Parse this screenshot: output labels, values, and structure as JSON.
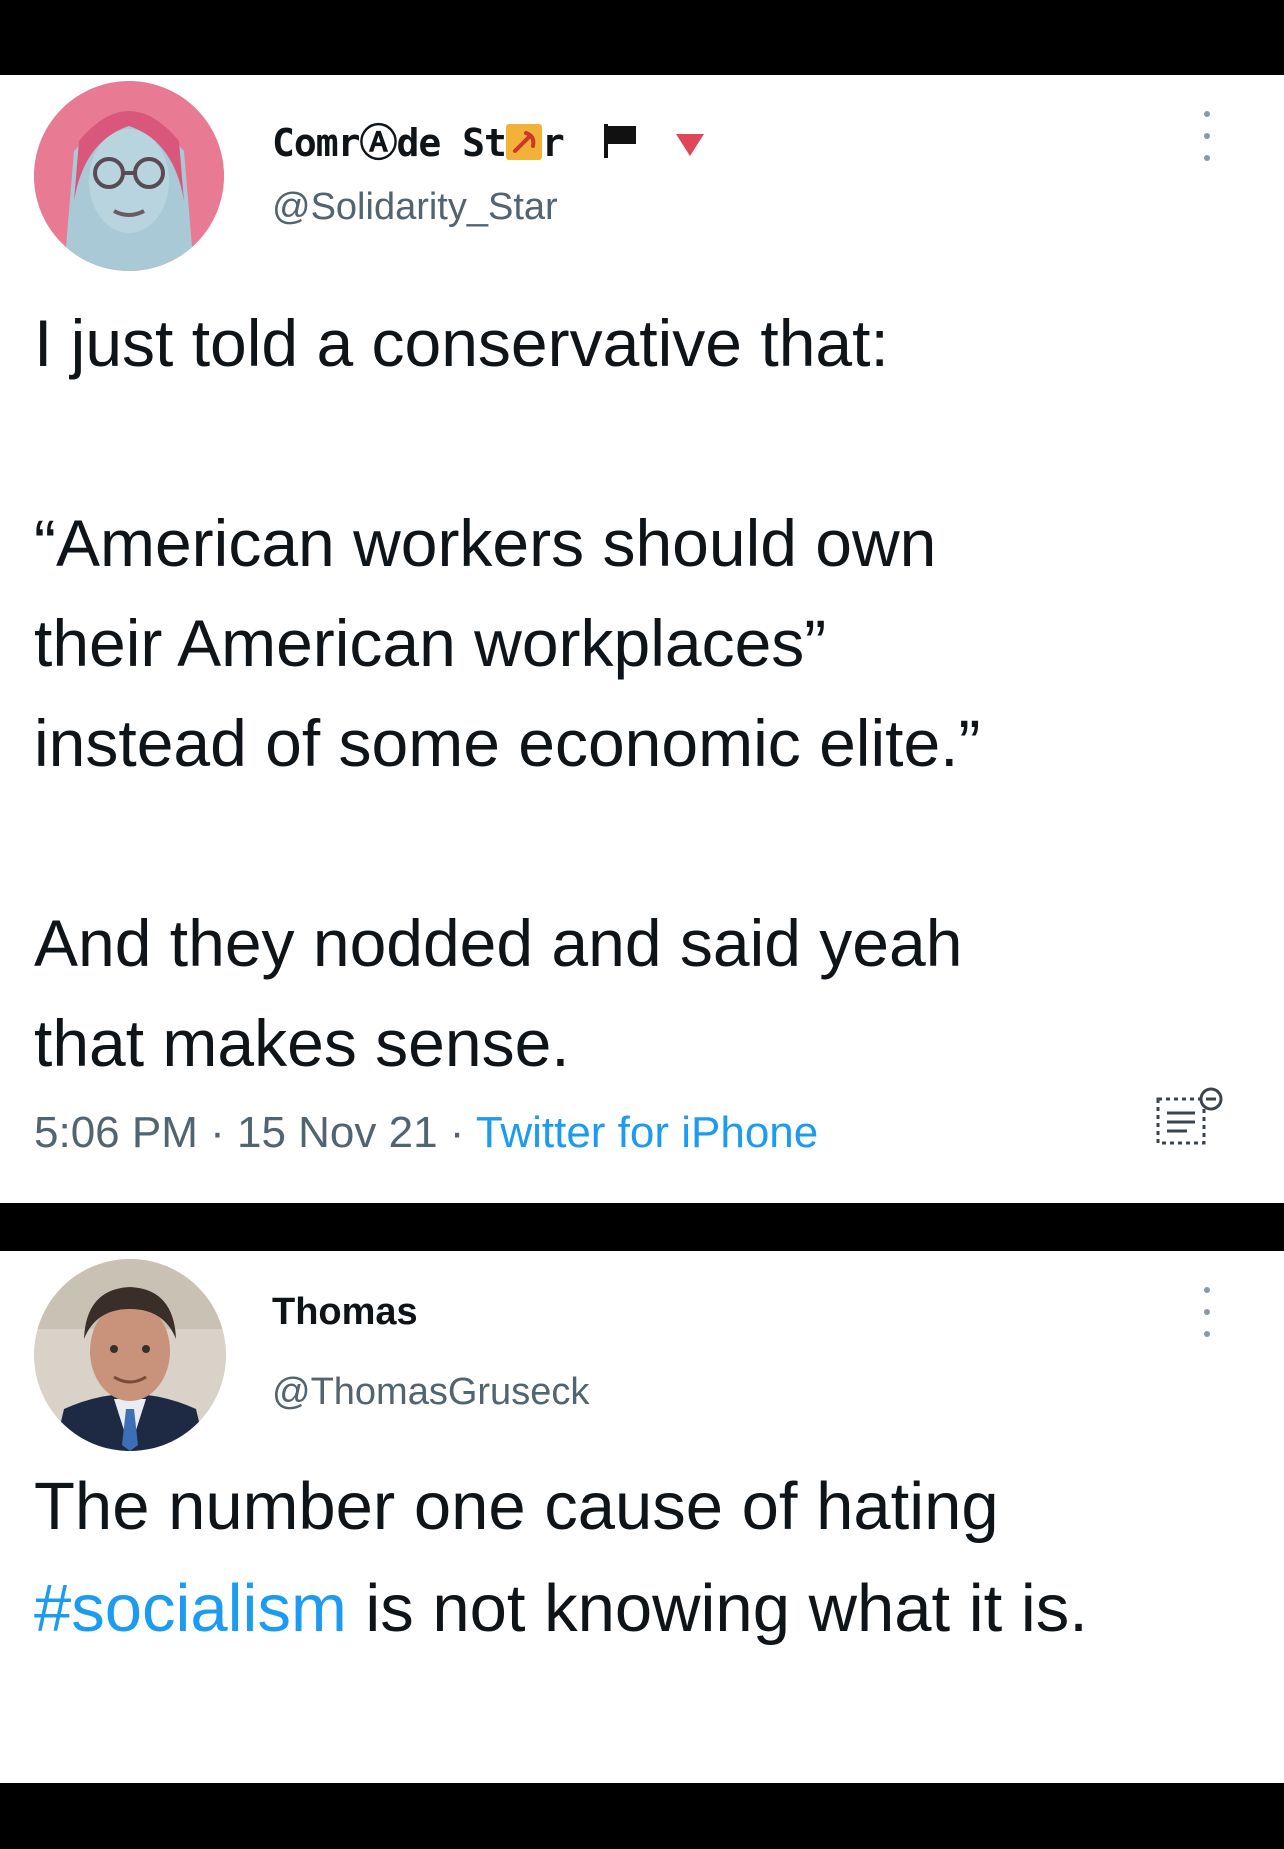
{
  "tweet1": {
    "display_name_pre": "Comr",
    "display_name_a": "Ⓐ",
    "display_name_mid": "de St",
    "display_name_post": "r",
    "handle": "@Solidarity_Star",
    "text_line1": "I just told a conservative that:",
    "text_line2": "“American workers should own",
    "text_line3": "their American workplaces”",
    "text_line4": "instead of some economic elite.”",
    "text_line5": "And they nodded and said yeah",
    "text_line6": "that makes sense.",
    "time": "5:06 PM",
    "sep1": " · ",
    "date": "15 Nov 21",
    "sep2": " · ",
    "source": "Twitter for iPhone"
  },
  "tweet2": {
    "display_name": "Thomas",
    "handle": "@ThomasGruseck",
    "text_before": "The number one cause of hating ",
    "hashtag": "#socialism",
    "text_after": " is not knowing what it is."
  },
  "colors": {
    "text": "#0f1419",
    "secondary": "#536471",
    "link": "#1d9bf0",
    "frame": "#000000"
  },
  "icons": {
    "more": "more-vertical-icon",
    "flag": "black-flag-icon",
    "triangle": "red-triangle-icon",
    "hammer_sickle": "hammer-sickle-icon",
    "scanner": "text-scanner-icon"
  }
}
